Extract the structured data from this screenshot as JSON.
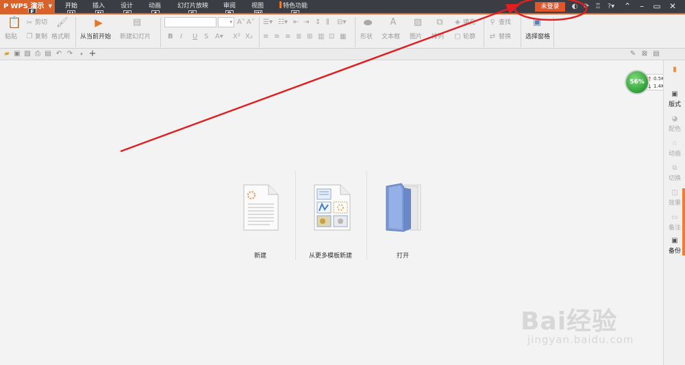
{
  "app": {
    "logo": "P",
    "name": "WPS 演示"
  },
  "menu_tabs": [
    {
      "label": "开始",
      "keytip": "H"
    },
    {
      "label": "插入",
      "keytip": "N"
    },
    {
      "label": "设计",
      "keytip": "G"
    },
    {
      "label": "动画",
      "keytip": "A"
    },
    {
      "label": "幻灯片放映",
      "keytip": "S"
    },
    {
      "label": "审阅",
      "keytip": "R"
    },
    {
      "label": "视图",
      "keytip": "W"
    },
    {
      "label": "特色功能",
      "keytip": "K"
    }
  ],
  "app_keytip": "F",
  "login_label": "未登录",
  "ribbon": {
    "paste": "粘贴",
    "cut": "剪切",
    "copy": "复制",
    "format_painter": "格式刷",
    "from_current": "从当前开始",
    "new_slide": "新建幻灯片",
    "shape": "形状",
    "textbox": "文本框",
    "picture": "图片",
    "arrange": "排列",
    "fill": "填充",
    "outline": "轮廓",
    "find": "查找",
    "replace": "替换",
    "selection_pane": "选择窗格"
  },
  "start_page": {
    "new_label": "新建",
    "template_label": "从更多模板新建",
    "open_label": "打开"
  },
  "right_panel": [
    {
      "label": "版式",
      "icon": "layout-icon",
      "active": true
    },
    {
      "label": "配色",
      "icon": "palette-icon",
      "active": false
    },
    {
      "label": "动画",
      "icon": "star-icon",
      "active": false
    },
    {
      "label": "切换",
      "icon": "transition-icon",
      "active": false
    },
    {
      "label": "效果",
      "icon": "effect-icon",
      "active": false
    },
    {
      "label": "备注",
      "icon": "note-icon",
      "active": false
    },
    {
      "label": "备份",
      "icon": "backup-icon",
      "active": true
    }
  ],
  "speed_widget": {
    "percent": "56%",
    "upload": "0.5K/s",
    "download": "1.4K/s"
  },
  "watermark": {
    "brand": "Bai经验",
    "url": "jingyan.baidu.com"
  },
  "colors": {
    "accent": "#d9622a",
    "titlebar": "#3a3d44",
    "annotation": "#e02020"
  }
}
